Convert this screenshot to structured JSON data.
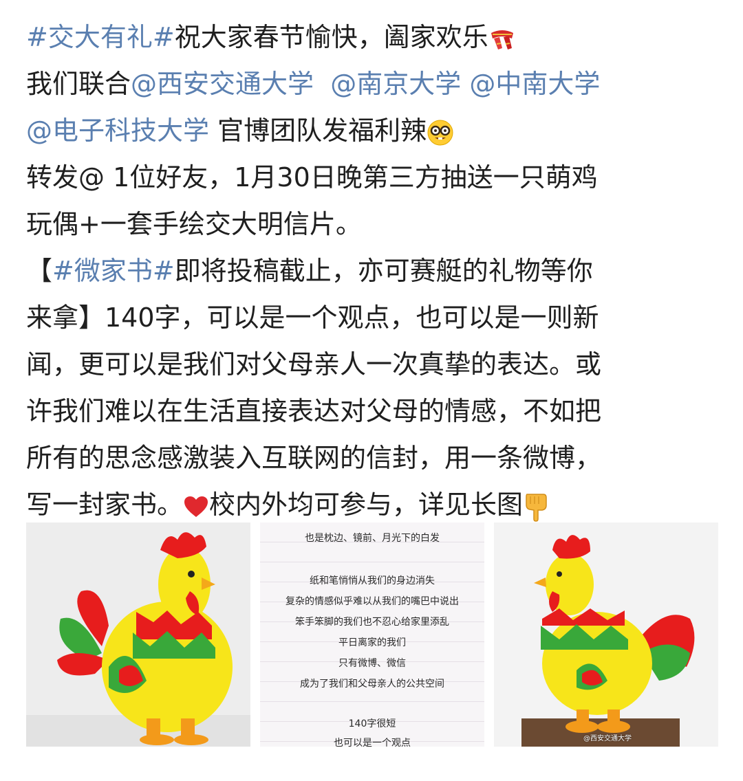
{
  "post": {
    "hashtag_1": "#交大有礼#",
    "line1_rest": "祝大家春节愉快，阖家欢乐",
    "line2_prefix": "我们联合",
    "mention_xjtu": "@西安交通大学",
    "mention_nju": "@南京大学",
    "mention_csu": "@中南大学",
    "mention_uestc": "@电子科技大学",
    "line3_rest": "官博团队发福利辣",
    "line4": "转发@ 1位好友，1月30日晚第三方抽送一只萌鸡",
    "line5": "玩偶+一套手绘交大明信片。",
    "bracket_open": "【",
    "hashtag_2": "#微家书#",
    "line6_rest": "即将投稿截止，亦可赛艇的礼物等你",
    "line7": "来拿】140字，可以是一个观点，也可以是一则新",
    "line8": "闻，更可以是我们对父母亲人一次真挚的表达。或",
    "line9": "许我们难以在生活直接表达对父母的情感，不如把",
    "line10": "所有的思念感激装入互联网的信封，用一条微博，",
    "line11_a": "写一封家书。",
    "line11_b": "校内外均可参与，详见长图"
  },
  "icons": {
    "scarf": "red-scarf-emoji",
    "nerd": "nerd-face-emoji",
    "heart": "red-heart-emoji",
    "hand": "pointing-down-emoji"
  },
  "colors": {
    "link": "#5a7fb0",
    "text": "#1f1f1f"
  },
  "images": {
    "letter_lines": [
      "也是枕边、镜前、月光下的白发",
      "纸和笔悄悄从我们的身边消失",
      "复杂的情感似乎难以从我们的嘴巴中说出",
      "笨手笨脚的我们也不忍心给家里添乱",
      "平日离家的我们",
      "只有微博、微信",
      "成为了我们和父母亲人的公共空间",
      "140字很短",
      "也可以是一个观点"
    ],
    "watermark_right": "@西安交通大学"
  }
}
